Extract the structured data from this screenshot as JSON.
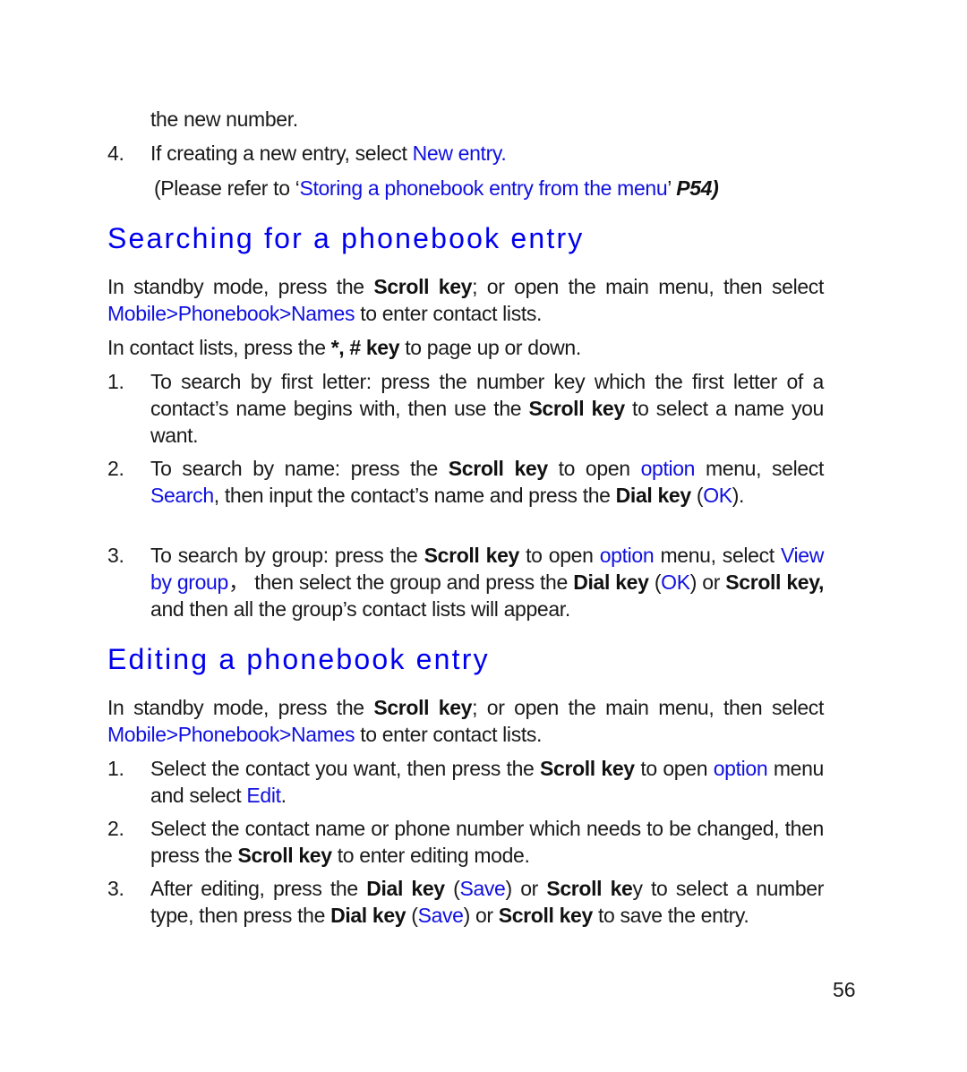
{
  "top": {
    "continuation": "the new number.",
    "item4": {
      "number": "4.",
      "text_before": "If creating a new entry, select ",
      "link": "New entry.",
      "ref_open": "(Please refer to ‘",
      "ref_link": "Storing a phonebook entry from the menu",
      "ref_close": "’ ",
      "ref_page": "P54)"
    }
  },
  "search_section": {
    "heading": "Searching for a phonebook entry",
    "intro": {
      "t1": "In standby mode, press the ",
      "b1": "Scroll key",
      "t2": "; or open the main menu, then select ",
      "link": "Mobile>Phonebook>Names",
      "t3": " to enter contact lists."
    },
    "paging": {
      "t1": "In contact lists, press the ",
      "b1": "*, # key",
      "t2": " to page up or down."
    },
    "items": [
      {
        "number": "1.",
        "t1": "To search by first letter: press the number key which the first letter of a contact’s name begins with, then use the ",
        "b1": "Scroll key",
        "t2": " to select a name you want."
      },
      {
        "number": "2.",
        "t1": "To search by name: press the ",
        "b1": "Scroll key",
        "t2": " to open ",
        "l1": "option",
        "t3": " menu, select ",
        "l2": "Search",
        "t4": ", then input the contact’s name and press the ",
        "b2": "Dial key",
        "t5": " (",
        "l3": "OK",
        "t6": ")."
      },
      {
        "number": "3.",
        "t1": "To search by group: press the ",
        "b1": "Scroll key",
        "t2": " to open ",
        "l1": "option",
        "t3": " menu, select ",
        "l2": "View by group",
        "t4": "， then select the group and press the ",
        "b2": "Dial key",
        "t5": " (",
        "l3": "OK",
        "t6": ") or ",
        "b3": "Scroll key,",
        "t7": " and then all the group’s contact lists will appear."
      }
    ]
  },
  "edit_section": {
    "heading": "Editing a phonebook entry",
    "intro": {
      "t1": "In standby mode, press the ",
      "b1": "Scroll key",
      "t2": "; or open the main menu, then select ",
      "link": "Mobile>Phonebook>Names",
      "t3": " to enter contact lists."
    },
    "items": [
      {
        "number": "1.",
        "t1": "Select the contact you want, then press the ",
        "b1": "Scroll key",
        "t2": " to open ",
        "l1": "option",
        "t3": " menu and select ",
        "l2": "Edit",
        "t4": "."
      },
      {
        "number": "2.",
        "t1": "Select the contact name or phone number which needs to be changed, then press the ",
        "b1": "Scroll key",
        "t2": " to enter editing mode."
      },
      {
        "number": "3.",
        "t1": "After editing, press the ",
        "b1": "Dial key",
        "t2": " (",
        "l1": "Save",
        "t3": ") or ",
        "b2": "Scroll ke",
        "t4": "y to select a number type, then press the ",
        "b3": "Dial key",
        "t5": " (",
        "l2": "Save",
        "t6": ") or ",
        "b4": "Scroll key",
        "t7": " to save the entry."
      }
    ]
  },
  "page_number": "56",
  "colors": {
    "link": "#1010e0",
    "heading": "#0000ee",
    "text": "#1a1a1a"
  }
}
